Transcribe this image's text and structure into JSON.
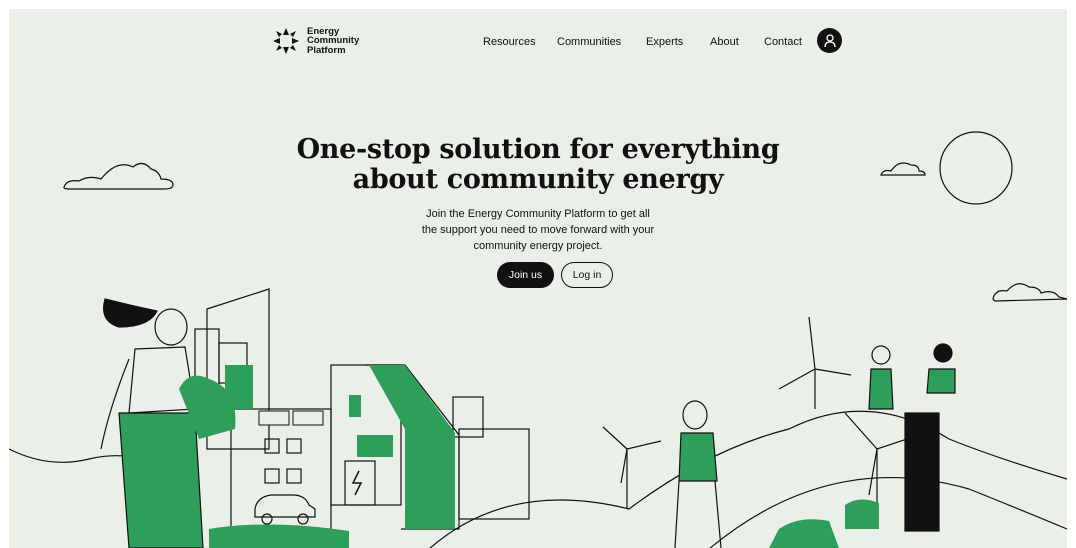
{
  "brand": {
    "name_line1": "Energy",
    "name_line2": "Community",
    "name_line3": "Platform"
  },
  "nav": {
    "items": [
      "Resources",
      "Communities",
      "Experts",
      "About",
      "Contact"
    ]
  },
  "hero": {
    "title_line1": "One-stop solution for everything",
    "title_line2": "about community energy",
    "subtitle_line1": "Join the Energy Community Platform to get all",
    "subtitle_line2": "the support you need to move forward with your",
    "subtitle_line3": "community energy project.",
    "join_label": "Join us",
    "login_label": "Log in"
  },
  "colors": {
    "background": "#eaefe8",
    "accent_green": "#2e9e5b",
    "ink": "#111111"
  }
}
